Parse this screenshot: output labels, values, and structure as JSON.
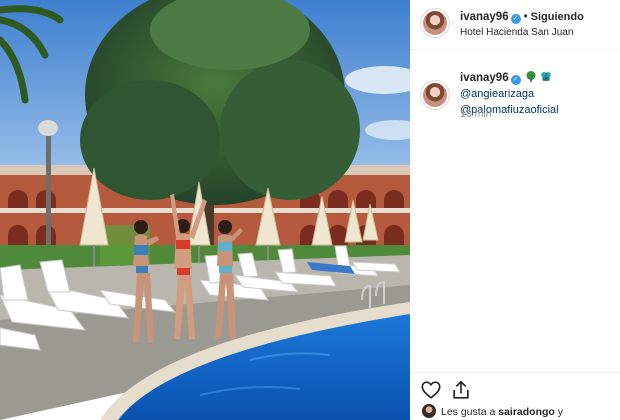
{
  "post": {
    "username": "ivanay96",
    "follow_status": "Siguiendo",
    "location": "Hotel Hacienda San Juan"
  },
  "caption": {
    "username": "ivanay96",
    "emoji_icons": [
      "green-tree-icon",
      "butterfly-icon"
    ],
    "mention_1": "@angiearizaga",
    "mention_2": "@palomafiuzaoficial",
    "time": "13 min"
  },
  "actions": {
    "icons": [
      "heart-icon",
      "share-icon"
    ]
  },
  "likes": {
    "prefix": "Les gusta a",
    "user": "sairadongo",
    "suffix": "y"
  },
  "colors": {
    "verified": "#3897f0",
    "mention": "#003569",
    "muted": "#8e8e8e",
    "pool": "#1e78d4",
    "sky": "#4f8fd6"
  }
}
